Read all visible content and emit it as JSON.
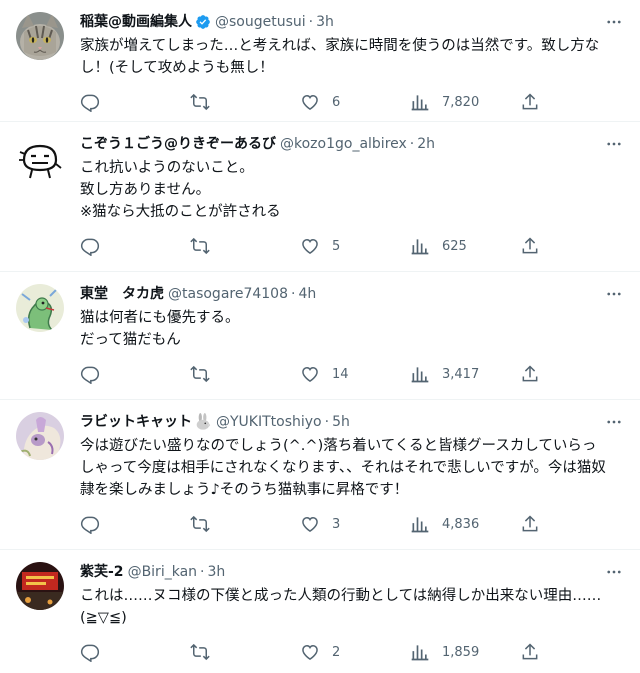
{
  "tweets": [
    {
      "name": "稲葉@動画編集人",
      "verified": true,
      "handle": "@sougetusui",
      "dot": "·",
      "time": "3h",
      "text": "家族が増えてしまった…と考えれば、家族に時間を使うのは当然です。致し方なし！(そして攻めようも無し！",
      "replies": "",
      "retweets": "",
      "likes": "6",
      "views": "7,820"
    },
    {
      "name": "こぞう１ごう@りきぞーあるび",
      "handle": "@kozo1go_albirex",
      "dot": "·",
      "time": "2h",
      "text": "これ抗いようのないこと。\n致し方ありません。\n※猫なら大抵のことが許される",
      "replies": "",
      "retweets": "",
      "likes": "5",
      "views": "625"
    },
    {
      "name": "東堂　タカ虎",
      "handle": "@tasogare74108",
      "dot": "·",
      "time": "4h",
      "text": "猫は何者にも優先する。\nだって猫だもん",
      "replies": "",
      "retweets": "",
      "likes": "14",
      "views": "3,417"
    },
    {
      "name": "ラビットキャット",
      "emoji": "rabbit",
      "handle": "@YUKITtoshiyo",
      "dot": "·",
      "time": "5h",
      "text": "今は遊びたい盛りなのでしょう(^.^)落ち着いてくると皆様グースカしていらっしゃって今度は相手にされなくなります、、それはそれで悲しいですが。今は猫奴隷を楽しみましょう♪そのうち猫執事に昇格です！",
      "replies": "",
      "retweets": "",
      "likes": "3",
      "views": "4,836"
    },
    {
      "name": "紫芙-2",
      "handle": "@Biri_kan",
      "dot": "·",
      "time": "3h",
      "text": "これは……ヌコ様の下僕と成った人類の行動としては納得しか出来ない理由……(≧▽≦)",
      "replies": "",
      "retweets": "",
      "likes": "2",
      "views": "1,859"
    }
  ],
  "icons": {
    "reply": "reply-icon",
    "retweet": "retweet-icon",
    "like": "heart-icon",
    "views": "views-icon",
    "share": "share-icon",
    "more": "more-icon",
    "verified": "verified-badge-icon"
  },
  "colors": {
    "verified": "#1d9bf0",
    "muted": "#536471",
    "text": "#0f1419",
    "divider": "#eff3f4"
  }
}
